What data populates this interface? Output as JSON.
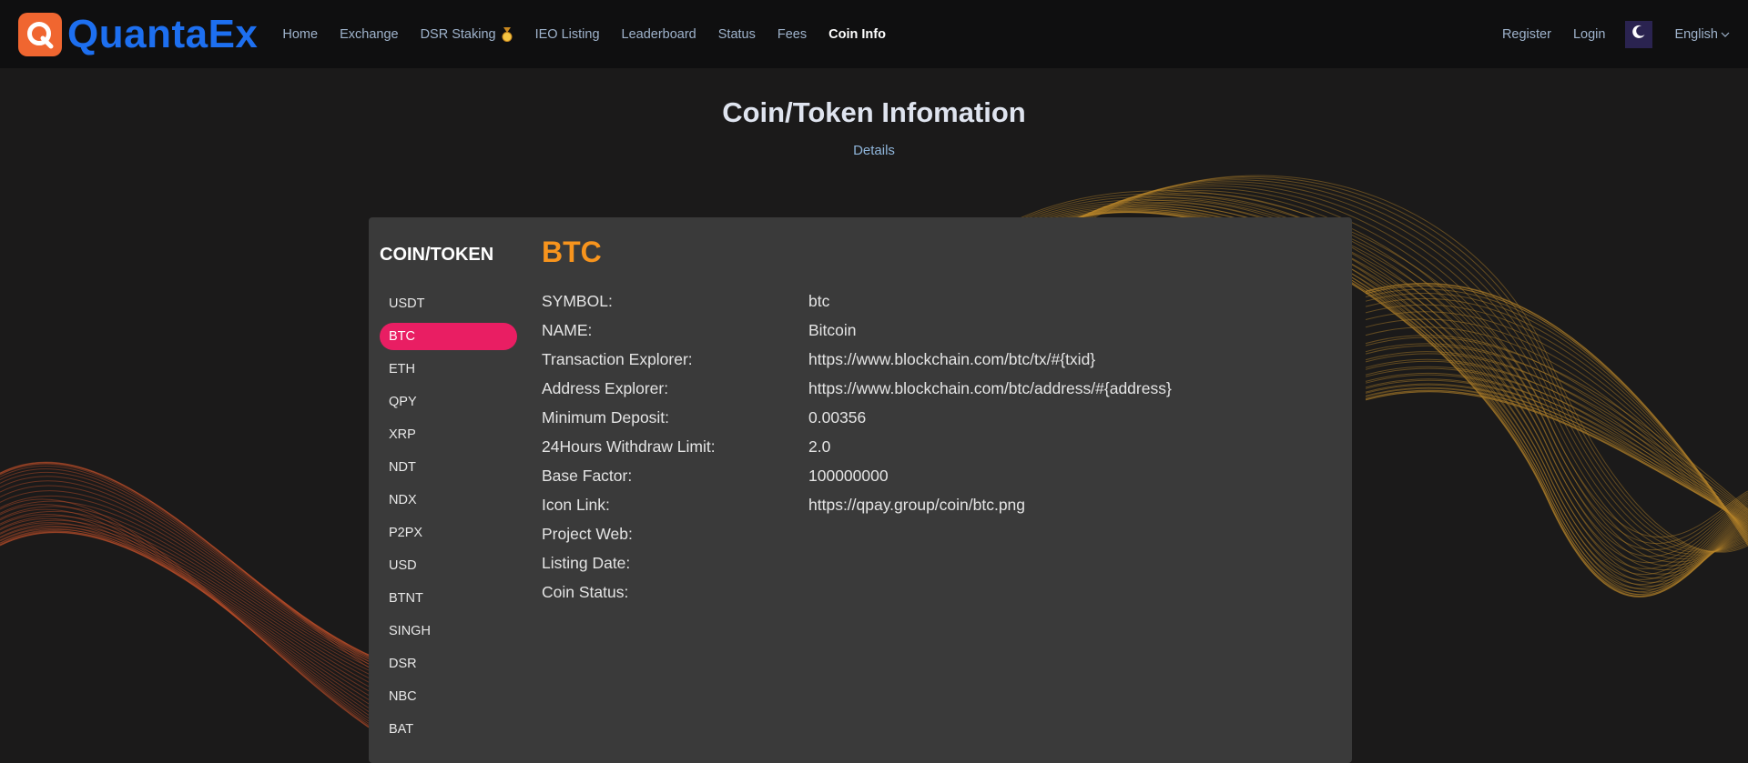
{
  "brand": {
    "name": "QuantaEx",
    "logo_letter": "Q",
    "logo_color": "#f06630",
    "text_color": "#1d6ff0"
  },
  "nav": {
    "items": [
      {
        "label": "Home",
        "active": false
      },
      {
        "label": "Exchange",
        "active": false
      },
      {
        "label": "DSR Staking",
        "active": false
      },
      {
        "label": "IEO Listing",
        "active": false
      },
      {
        "label": "Leaderboard",
        "active": false
      },
      {
        "label": "Status",
        "active": false
      },
      {
        "label": "Fees",
        "active": false
      },
      {
        "label": "Coin Info",
        "active": true
      }
    ],
    "register": "Register",
    "login": "Login",
    "theme_icon": "moon-icon",
    "language": "English"
  },
  "header": {
    "title": "Coin/Token Infomation",
    "subtitle": "Details"
  },
  "sidebar": {
    "title": "COIN/TOKEN",
    "coins": [
      "USDT",
      "BTC",
      "ETH",
      "QPY",
      "XRP",
      "NDT",
      "NDX",
      "P2PX",
      "USD",
      "BTNT",
      "SINGH",
      "DSR",
      "NBC",
      "BAT"
    ],
    "selected": "BTC",
    "selected_color": "#e91e63"
  },
  "detail": {
    "coin": "BTC",
    "accent": "#f7941d",
    "rows": [
      {
        "label": "SYMBOL:",
        "value": "btc"
      },
      {
        "label": "NAME:",
        "value": "Bitcoin"
      },
      {
        "label": "Transaction Explorer:",
        "value": "https://www.blockchain.com/btc/tx/#{txid}"
      },
      {
        "label": "Address Explorer:",
        "value": "https://www.blockchain.com/btc/address/#{address}"
      },
      {
        "label": "Minimum Deposit:",
        "value": "0.00356"
      },
      {
        "label": "24Hours Withdraw Limit:",
        "value": "2.0"
      },
      {
        "label": "Base Factor:",
        "value": "100000000"
      },
      {
        "label": "Icon Link:",
        "value": "https://qpay.group/coin/btc.png"
      },
      {
        "label": "Project Web:",
        "value": ""
      },
      {
        "label": "Listing Date:",
        "value": ""
      },
      {
        "label": "Coin Status:",
        "value": ""
      }
    ]
  }
}
